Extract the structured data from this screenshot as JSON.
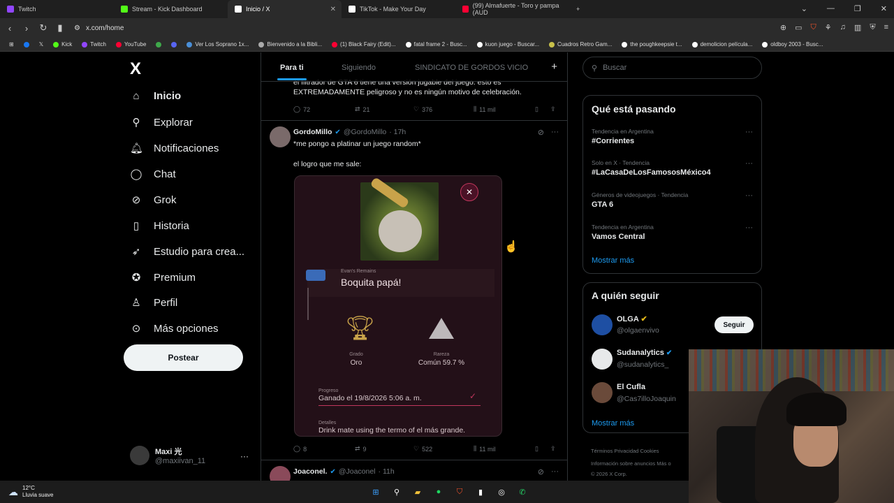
{
  "browser": {
    "tabs": [
      {
        "label": "Twitch",
        "color": "#9146ff"
      },
      {
        "label": "Stream - Kick Dashboard",
        "color": "#53fc18"
      },
      {
        "label": "Inicio / X",
        "color": "#ffffff"
      },
      {
        "label": "TikTok - Make Your Day",
        "color": "#ffffff"
      },
      {
        "label": "(99) Almafuerte - Toro y pampa (AUD",
        "color": "#ff0033"
      }
    ],
    "url": "x.com/home",
    "bookmarks": [
      "Kick",
      "Twitch",
      "YouTube",
      "Ver Los Soprano 1x...",
      "Bienvenido a la Bibli...",
      "(1) Black Fairy (Edit)...",
      "fatal frame 2 - Busc...",
      "kuon juego - Buscar...",
      "Cuadros Retro Gam...",
      "the poughkeepsie t...",
      "demolicion película...",
      "oldboy 2003 - Busc..."
    ]
  },
  "nav": {
    "logo": "X",
    "items": [
      {
        "label": "Inicio",
        "icon": "home-icon",
        "glyph": "⌂"
      },
      {
        "label": "Explorar",
        "icon": "search-icon",
        "glyph": "⚲"
      },
      {
        "label": "Notificaciones",
        "icon": "bell-icon",
        "glyph": "🔔︎"
      },
      {
        "label": "Chat",
        "icon": "chat-icon",
        "glyph": "◯"
      },
      {
        "label": "Grok",
        "icon": "grok-icon",
        "glyph": "⊘"
      },
      {
        "label": "Historia",
        "icon": "bookmark-icon",
        "glyph": "▯"
      },
      {
        "label": "Estudio para crea...",
        "icon": "rocket-icon",
        "glyph": "➶"
      },
      {
        "label": "Premium",
        "icon": "verified-icon",
        "glyph": "✪"
      },
      {
        "label": "Perfil",
        "icon": "person-icon",
        "glyph": "♙"
      },
      {
        "label": "Más opciones",
        "icon": "more-icon",
        "glyph": "⊙"
      }
    ],
    "post_label": "Postear",
    "user": {
      "name": "Maxi 光",
      "handle": "@maxiivan_11"
    }
  },
  "feed": {
    "tabs": [
      "Para ti",
      "Siguiendo",
      "SINDICATO DE GORDOS VICIO"
    ],
    "prev_tweet": {
      "text": "el filtrador de GTA 6 tiene una versión jugable del juego. esto es EXTREMADAMENTE peligroso y no es ningún motivo de celebración.",
      "replies": "72",
      "reposts": "21",
      "likes": "376",
      "views": "11 mil"
    },
    "tweet": {
      "name": "GordoMillo",
      "handle": "@GordoMillo",
      "time": "· 17h",
      "line1": "*me pongo a platinar un juego random*",
      "line2": "el logro que me sale:",
      "replies": "8",
      "reposts": "9",
      "likes": "522",
      "views": "11 mil",
      "card": {
        "game": "Evan's Remains",
        "title": "Boquita papá!",
        "grade_label": "Grado",
        "grade_value": "Oro",
        "rarity_label": "Rareza",
        "rarity_value": "Común 59.7 %",
        "progress_label": "Progreso",
        "progress_value": "Ganado el 19/8/2026  5:06 a. m.",
        "details_label": "Detalles",
        "details_value": "Drink mate using the termo of el más grande."
      }
    },
    "next_tweet": {
      "name": "Joaconel.",
      "handle": "@Joaconel",
      "time": "· 11h"
    }
  },
  "right": {
    "search_placeholder": "Buscar",
    "trends_title": "Qué está pasando",
    "trends": [
      {
        "meta": "Tendencia en Argentina",
        "name": "#Corrientes"
      },
      {
        "meta": "Solo en X · Tendencia",
        "name": "#LaCasaDeLosFamososMéxico4"
      },
      {
        "meta": "Géneros de videojuegos · Tendencia",
        "name": "GTA 6"
      },
      {
        "meta": "Tendencia en Argentina",
        "name": "Vamos Central"
      }
    ],
    "show_more": "Mostrar más",
    "follow_title": "A quién seguir",
    "follow": [
      {
        "name": "OLGA",
        "handle": "@olgaenvivo",
        "color": "#1e4fa3"
      },
      {
        "name": "Sudanalytics",
        "handle": "@sudanalytics_",
        "color": "#e7e9ea"
      },
      {
        "name": "El Cufla",
        "handle": "@Cas7illoJoaquin",
        "color": "#6a4a3a"
      }
    ],
    "follow_btn": "Seguir",
    "footer1": "Términos   Privacidad   Cookies",
    "footer2": "Información sobre anuncios   Más o",
    "footer3": "© 2026 X Corp."
  },
  "taskbar": {
    "temp": "12°C",
    "weather": "Lluvia suave"
  }
}
